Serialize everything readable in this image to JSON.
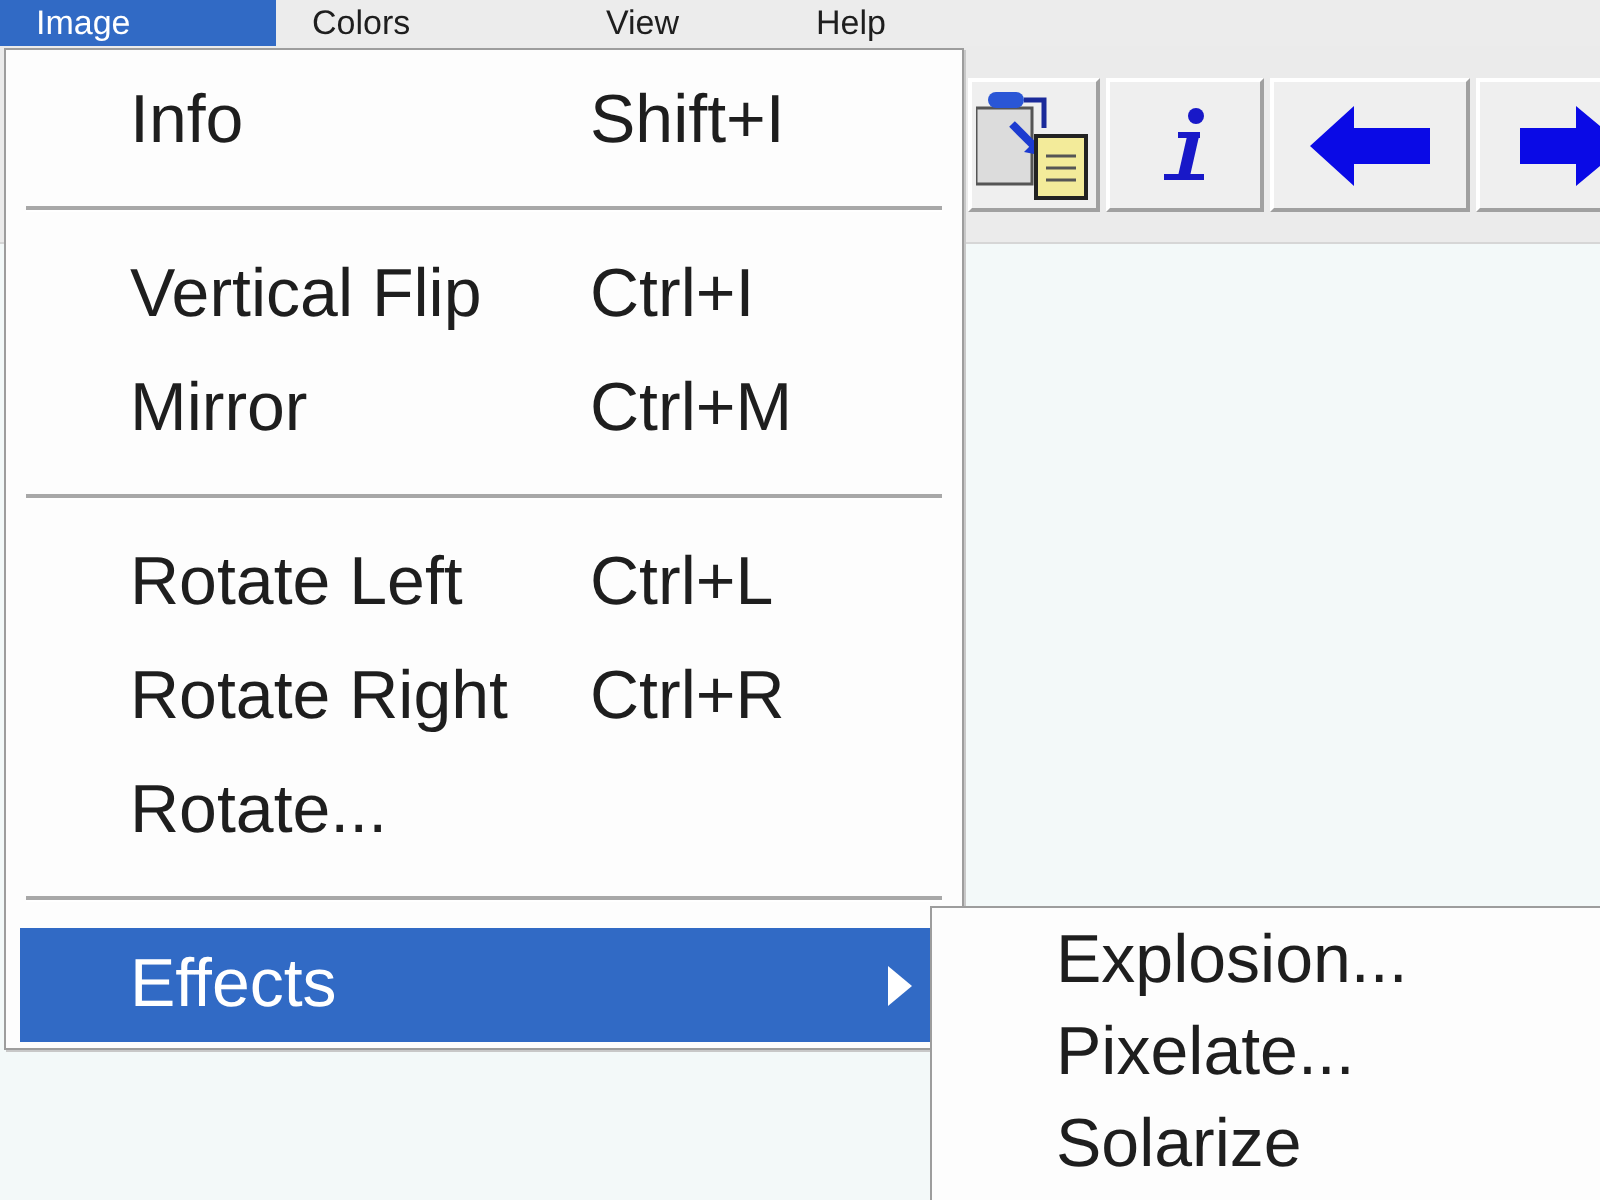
{
  "menu_bar": [
    {
      "label": "Image",
      "selected": true
    },
    {
      "label": "Colors",
      "selected": false
    },
    {
      "label": "View",
      "selected": false
    },
    {
      "label": "Help",
      "selected": false
    }
  ],
  "menu": {
    "items": [
      {
        "kind": "item",
        "label": "Info",
        "shortcut": "Shift+I",
        "selected": false
      },
      {
        "kind": "separator"
      },
      {
        "kind": "item",
        "label": "Vertical Flip",
        "shortcut": "Ctrl+I",
        "selected": false
      },
      {
        "kind": "item",
        "label": "Mirror",
        "shortcut": "Ctrl+M",
        "selected": false
      },
      {
        "kind": "separator"
      },
      {
        "kind": "item",
        "label": "Rotate Left",
        "shortcut": "Ctrl+L",
        "selected": false
      },
      {
        "kind": "item",
        "label": "Rotate Right",
        "shortcut": "Ctrl+R",
        "selected": false
      },
      {
        "kind": "item",
        "label": "Rotate...",
        "selected": false
      },
      {
        "kind": "separator"
      },
      {
        "kind": "submenu",
        "label": "Effects",
        "selected": true
      }
    ]
  },
  "submenu": {
    "items": [
      {
        "label": "Explosion...",
        "selected": false
      },
      {
        "label": "Pixelate...",
        "selected": false
      },
      {
        "label": "Solarize",
        "selected": false
      }
    ]
  }
}
